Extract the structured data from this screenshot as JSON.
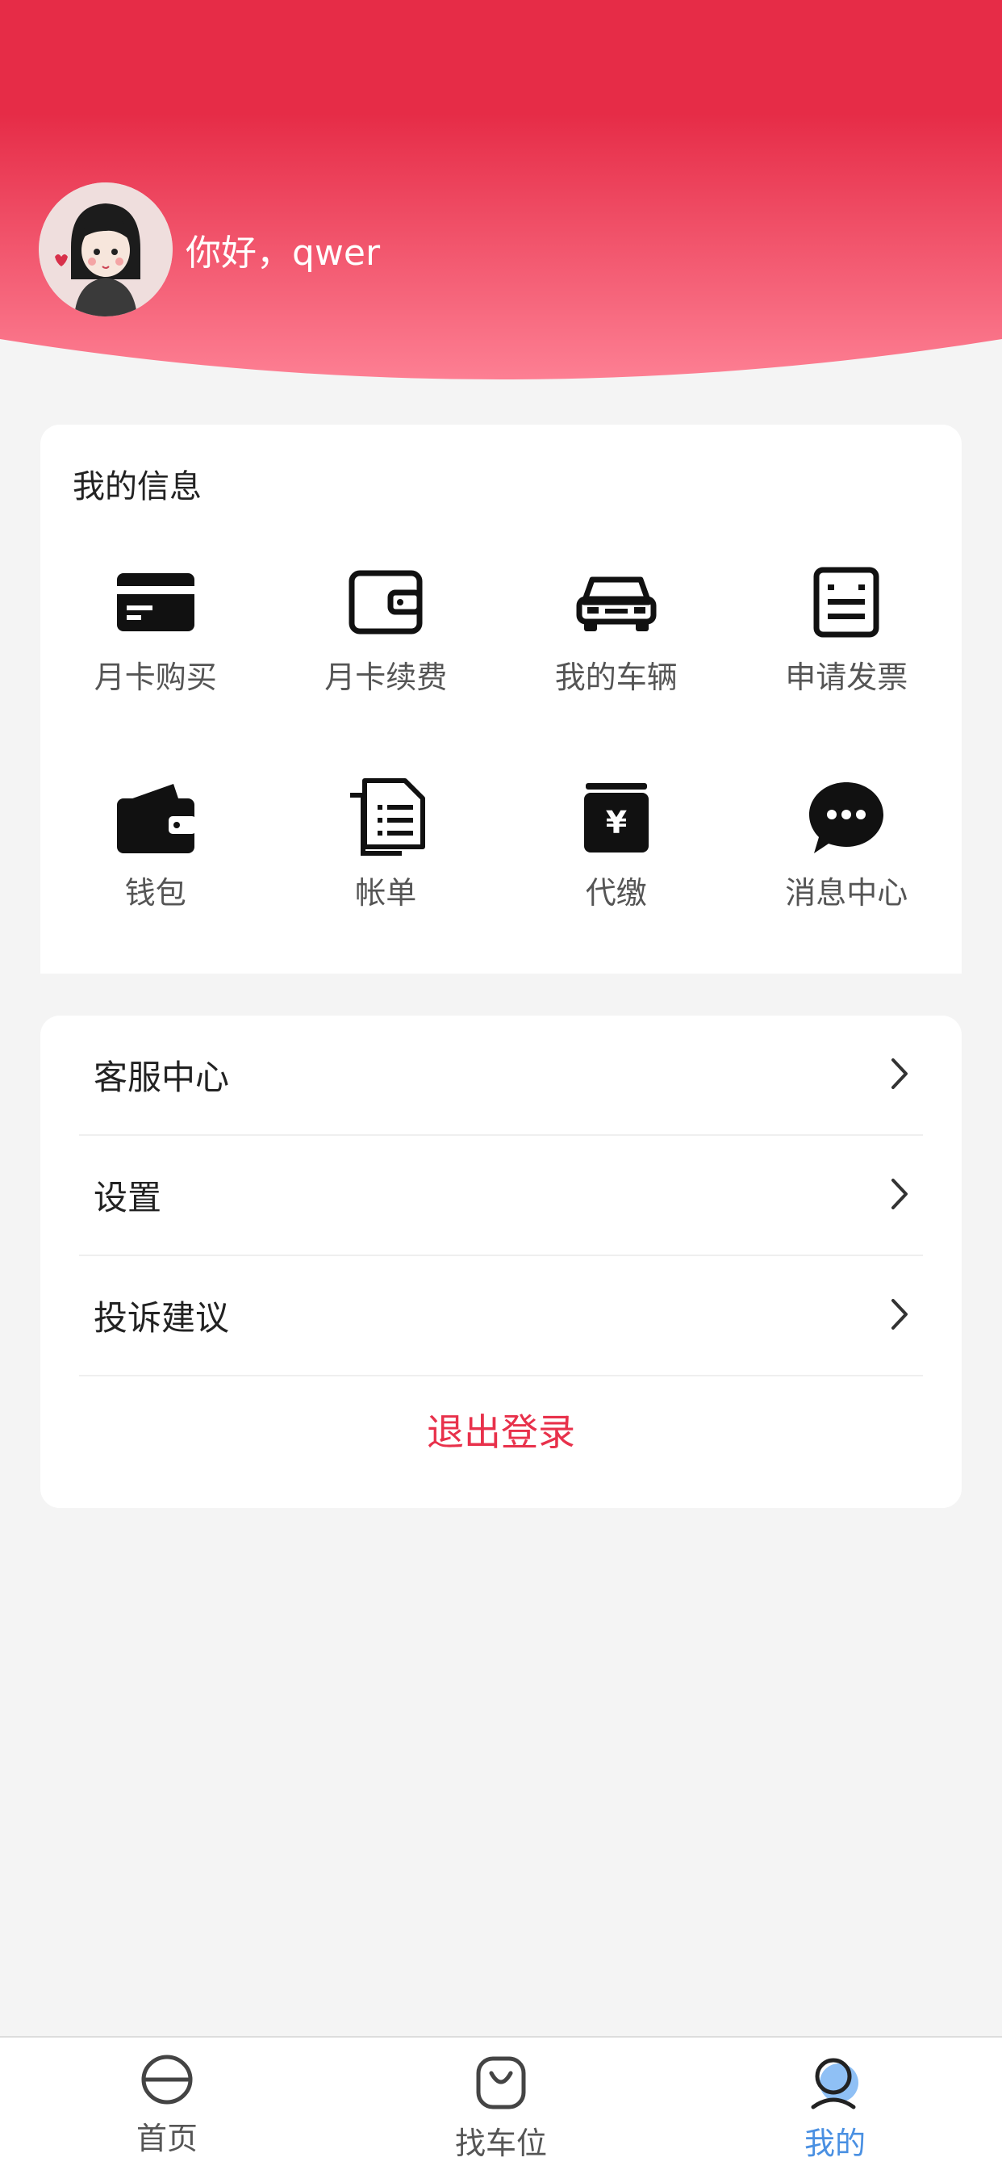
{
  "header": {
    "greeting": "你好，qwer",
    "gradient_top": "#e62c47",
    "gradient_bottom": "#fd7d92"
  },
  "my_info": {
    "title": "我的信息",
    "items": [
      {
        "label": "月卡购买",
        "icon": "card-icon"
      },
      {
        "label": "月卡续费",
        "icon": "wallet-outline-icon"
      },
      {
        "label": "我的车辆",
        "icon": "car-icon"
      },
      {
        "label": "申请发票",
        "icon": "invoice-icon"
      },
      {
        "label": "钱包",
        "icon": "wallet-icon"
      },
      {
        "label": "帐单",
        "icon": "bill-icon"
      },
      {
        "label": "代缴",
        "icon": "payment-yen-icon"
      },
      {
        "label": "消息中心",
        "icon": "chat-bubble-icon"
      }
    ]
  },
  "menu": {
    "items": [
      {
        "label": "客服中心"
      },
      {
        "label": "设置"
      },
      {
        "label": "投诉建议"
      }
    ],
    "logout": "退出登录",
    "logout_color": "#e8314b"
  },
  "tabbar": {
    "tabs": [
      {
        "label": "首页",
        "icon": "home-icon"
      },
      {
        "label": "找车位",
        "icon": "parking-bag-icon"
      },
      {
        "label": "我的",
        "icon": "user-icon",
        "active": true
      }
    ],
    "active_color": "#4a90e2"
  }
}
